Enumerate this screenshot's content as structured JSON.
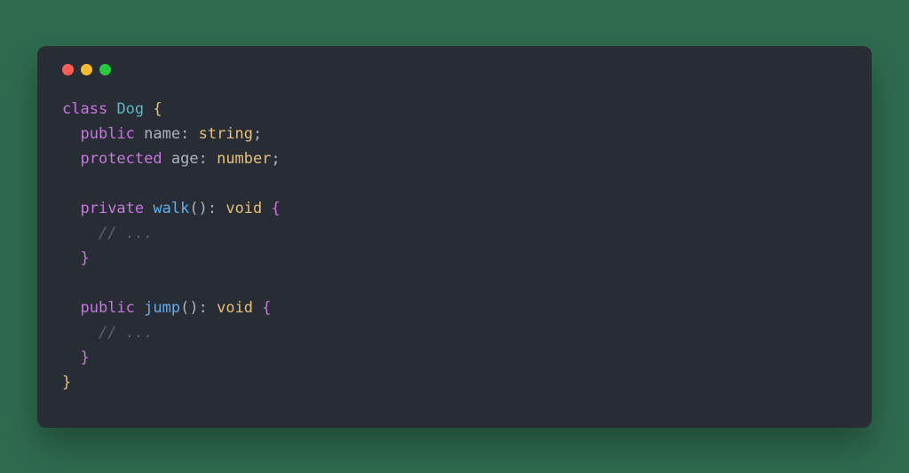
{
  "window": {
    "controls": [
      "red",
      "yellow",
      "green"
    ]
  },
  "code": {
    "line1": {
      "kw": "class",
      "name": "Dog",
      "brace": "{"
    },
    "line2": {
      "indent": "  ",
      "modifier": "public",
      "prop": "name",
      "colon": ":",
      "type": "string",
      "semi": ";"
    },
    "line3": {
      "indent": "  ",
      "modifier": "protected",
      "prop": "age",
      "colon": ":",
      "type": "number",
      "semi": ";"
    },
    "line4": "",
    "line5": {
      "indent": "  ",
      "modifier": "private",
      "method": "walk",
      "parens": "()",
      "colon": ":",
      "type": "void",
      "brace": "{"
    },
    "line6": {
      "indent": "    ",
      "comment": "// ..."
    },
    "line7": {
      "indent": "  ",
      "brace": "}"
    },
    "line8": "",
    "line9": {
      "indent": "  ",
      "modifier": "public",
      "method": "jump",
      "parens": "()",
      "colon": ":",
      "type": "void",
      "brace": "{"
    },
    "line10": {
      "indent": "    ",
      "comment": "// ..."
    },
    "line11": {
      "indent": "  ",
      "brace": "}"
    },
    "line12": {
      "brace": "}"
    }
  }
}
